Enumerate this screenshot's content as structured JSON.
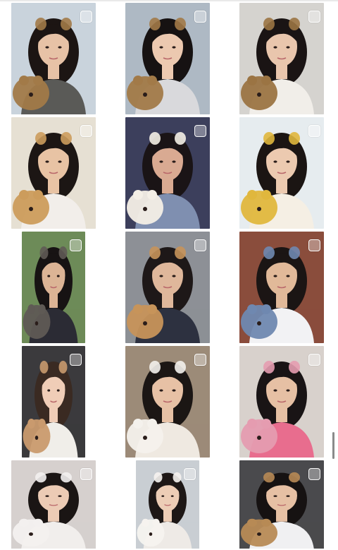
{
  "gallery": {
    "selection_checkbox_icon": "square-outline",
    "accent": "#ffffff",
    "photos": [
      {
        "subject": "girl-leopard-ears",
        "bg": "#c9d3dc",
        "skin": "#e7c2a6",
        "hair": "#1c1513",
        "top": "#5a5a57",
        "prop": "#a27a48"
      },
      {
        "subject": "girl-leopard-ears-car",
        "bg": "#aeb9c4",
        "skin": "#ecc9b0",
        "hair": "#161212",
        "top": "#d9d9dc",
        "prop": "#a27a48"
      },
      {
        "subject": "girl-teddy-bear",
        "bg": "#d5d3cf",
        "skin": "#e9c6ad",
        "hair": "#1a1414",
        "top": "#f1eee9",
        "prop": "#9b7443"
      },
      {
        "subject": "girl-golden-retriever",
        "bg": "#e6e0d3",
        "skin": "#e8c3a4",
        "hair": "#1c1614",
        "top": "#f2eeea",
        "prop": "#cc9c5c"
      },
      {
        "subject": "girl-dog-plush",
        "bg": "#3c3f5c",
        "skin": "#d9aa92",
        "hair": "#1a1416",
        "top": "#7f8fb0",
        "prop": "#f4efe6"
      },
      {
        "subject": "girl-tiger-ears",
        "bg": "#e6ecef",
        "skin": "#eccab0",
        "hair": "#1b1513",
        "top": "#f5efe4",
        "prop": "#e0b73d"
      },
      {
        "subject": "girl-elephant",
        "bg": "#6d8b58",
        "skin": "#dcb495",
        "hair": "#171313",
        "top": "#2b2b34",
        "prop": "#5f5a55"
      },
      {
        "subject": "girl-shiba-plush",
        "bg": "#8d9096",
        "skin": "#dfb79b",
        "hair": "#1e1818",
        "top": "#2d3140",
        "prop": "#c7945a"
      },
      {
        "subject": "girl-brick-wall",
        "bg": "#8a4d3c",
        "skin": "#e1b999",
        "hair": "#1b1514",
        "top": "#f2f2f4",
        "prop": "#6f88b0"
      },
      {
        "subject": "girl-puppy-filter",
        "bg": "#3b3a3d",
        "skin": "#f0cdb7",
        "hair": "#3a2a22",
        "top": "#f0eee9",
        "prop": "#c99a6e"
      },
      {
        "subject": "girl-white-puppy",
        "bg": "#9c8b78",
        "skin": "#e7c1a5",
        "hair": "#1b1614",
        "top": "#efe9e1",
        "prop": "#f4f1ec"
      },
      {
        "subject": "girl-pink-bear",
        "bg": "#d8d1cc",
        "skin": "#e6c0a4",
        "hair": "#191415",
        "top": "#e86d8e",
        "prop": "#e59cb0"
      },
      {
        "subject": "girl-bunny-plush",
        "bg": "#d6d0ce",
        "skin": "#eccbb5",
        "hair": "#1a1514",
        "top": "#f1eeec",
        "prop": "#f3f0ef"
      },
      {
        "subject": "girl-sheep-hood",
        "bg": "#c9ced3",
        "skin": "#edcdb6",
        "hair": "#1d1716",
        "top": "#eeeae6",
        "prop": "#f6f3ef"
      },
      {
        "subject": "girl-teddy-car",
        "bg": "#4a4a4d",
        "skin": "#e6c0a4",
        "hair": "#161212",
        "top": "#f0f0f2",
        "prop": "#b78a55"
      }
    ]
  }
}
